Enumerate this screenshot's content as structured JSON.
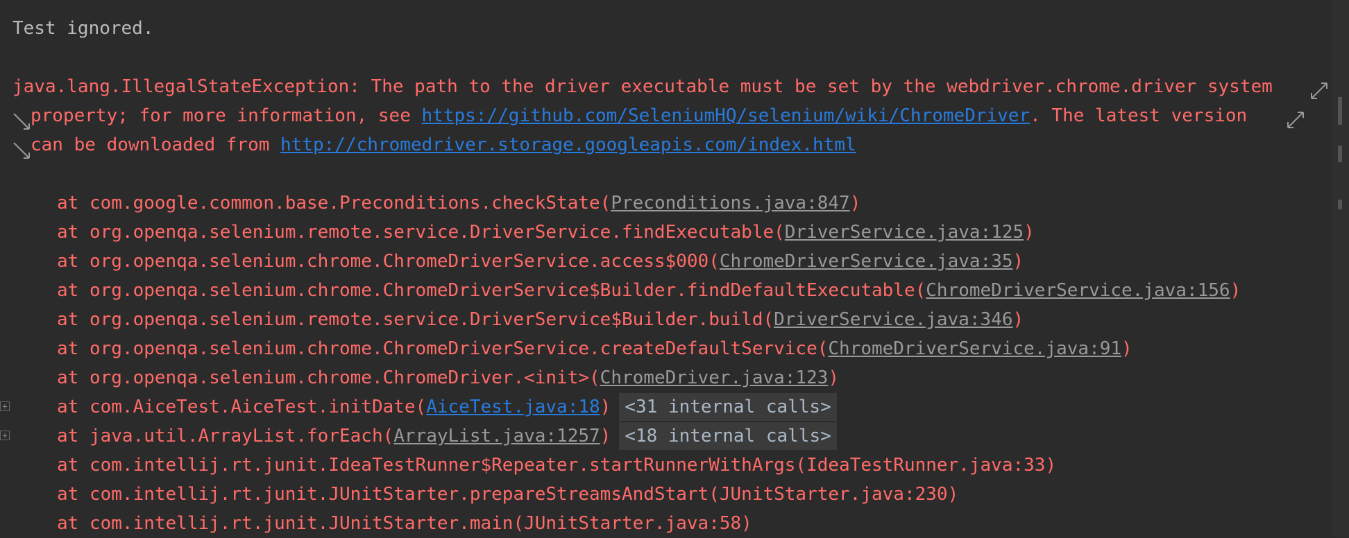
{
  "console": {
    "status": "Test ignored.",
    "exception": {
      "line1": "java.lang.IllegalStateException: The path to the driver executable must be set by the webdriver.chrome.driver system",
      "line2_pre": "property; for more information, see ",
      "line2_link": "https://github.com/SeleniumHQ/selenium/wiki/ChromeDriver",
      "line2_post": ". The latest version",
      "line3_pre": "can be downloaded from ",
      "line3_link": "http://chromedriver.storage.googleapis.com/index.html"
    },
    "frames": [
      {
        "prefix": "at com.google.common.base.Preconditions.checkState(",
        "source": "Preconditions.java:847",
        "suffix": ")"
      },
      {
        "prefix": "at org.openqa.selenium.remote.service.DriverService.findExecutable(",
        "source": "DriverService.java:125",
        "suffix": ")"
      },
      {
        "prefix": "at org.openqa.selenium.chrome.ChromeDriverService.access$000(",
        "source": "ChromeDriverService.java:35",
        "suffix": ")"
      },
      {
        "prefix": "at org.openqa.selenium.chrome.ChromeDriverService$Builder.findDefaultExecutable(",
        "source": "ChromeDriverService.java:156",
        "suffix": ")"
      },
      {
        "prefix": "at org.openqa.selenium.remote.service.DriverService$Builder.build(",
        "source": "DriverService.java:346",
        "suffix": ")"
      },
      {
        "prefix": "at org.openqa.selenium.chrome.ChromeDriverService.createDefaultService(",
        "source": "ChromeDriverService.java:91",
        "suffix": ")"
      },
      {
        "prefix": "at org.openqa.selenium.chrome.ChromeDriver.<init>(",
        "source": "ChromeDriver.java:123",
        "suffix": ")"
      },
      {
        "prefix": "at com.AiceTest.AiceTest.initDate(",
        "source": "AiceTest.java:18",
        "suffix": ")",
        "fold": "<31 internal calls>"
      },
      {
        "prefix": "at java.util.ArrayList.forEach(",
        "source": "ArrayList.java:1257",
        "suffix": ")",
        "fold": "<18 internal calls>"
      },
      {
        "text": "at com.intellij.rt.junit.IdeaTestRunner$Repeater.startRunnerWithArgs(IdeaTestRunner.java:33)"
      },
      {
        "text": "at com.intellij.rt.junit.JUnitStarter.prepareStreamsAndStart(JUnitStarter.java:230)"
      },
      {
        "text": "at com.intellij.rt.junit.JUnitStarter.main(JUnitStarter.java:58)"
      }
    ]
  },
  "icons": {
    "soft_wrap": "soft-wrap-icon",
    "expand": "expand-fold-icon"
  }
}
